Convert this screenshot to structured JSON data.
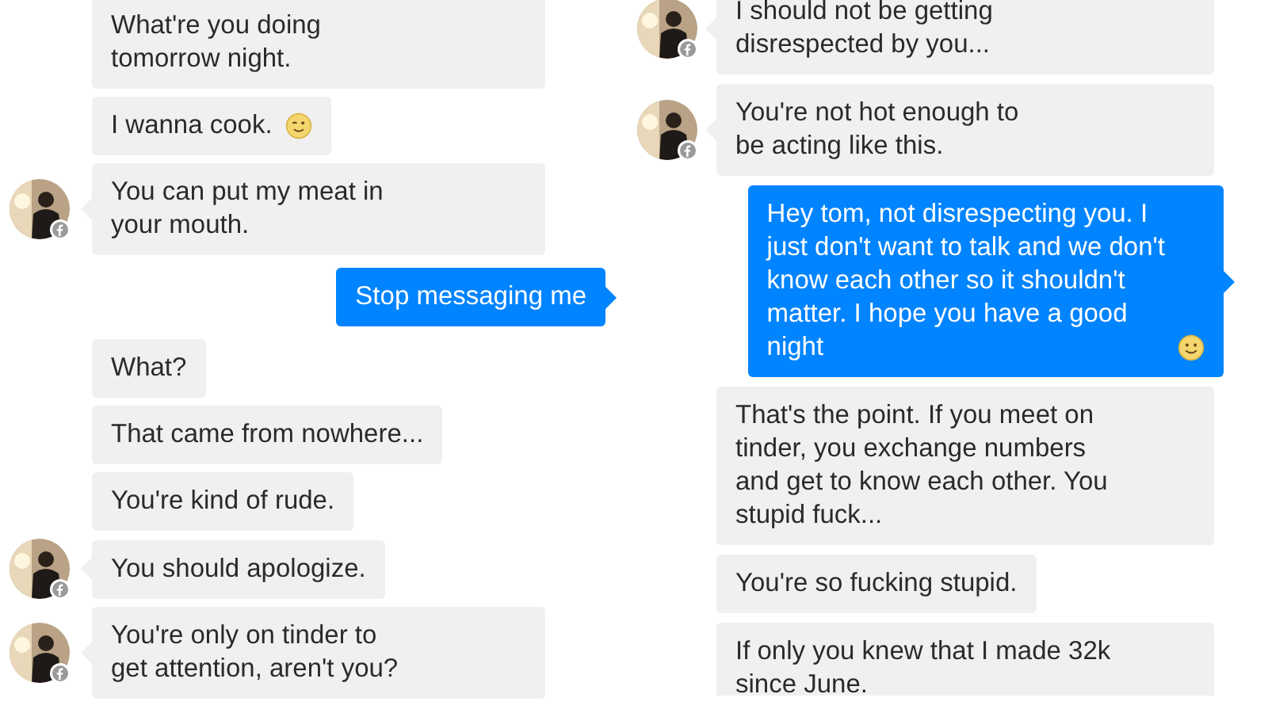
{
  "columns": [
    {
      "messages": [
        {
          "kind": "received",
          "avatar": false,
          "text": "What're you doing\ntomorrow night."
        },
        {
          "kind": "received",
          "avatar": false,
          "text": "I wanna cook.",
          "emoji": {
            "kind": "wink"
          }
        },
        {
          "kind": "received",
          "avatar": true,
          "text": "You can put my meat in\nyour mouth."
        },
        {
          "kind": "sent",
          "text": "Stop messaging me"
        },
        {
          "kind": "received",
          "avatar": false,
          "text": "What?"
        },
        {
          "kind": "received",
          "avatar": false,
          "text": "That came from nowhere..."
        },
        {
          "kind": "received",
          "avatar": false,
          "text": "You're kind of rude."
        },
        {
          "kind": "received",
          "avatar": true,
          "text": "You should apologize."
        },
        {
          "kind": "received",
          "avatar": true,
          "text": "You're only on tinder to\nget attention, aren't you?"
        }
      ]
    },
    {
      "messages": [
        {
          "kind": "received",
          "avatar": true,
          "text": "I should not be getting\ndisrespected by you..."
        },
        {
          "kind": "received",
          "avatar": true,
          "text": "You're not hot enough to\nbe acting like this."
        },
        {
          "kind": "sent",
          "text": "Hey tom, not disrespecting you.  I\njust don't want to talk and we don't\nknow each other so it shouldn't\nmatter. I hope you have a good\nnight",
          "emoji": {
            "kind": "smile"
          }
        },
        {
          "kind": "received",
          "avatar": false,
          "text": "That's the point.  If you meet on\ntinder, you exchange numbers\nand get to know each other.  You\nstupid fuck..."
        },
        {
          "kind": "received",
          "avatar": false,
          "text": "You're so fucking stupid."
        },
        {
          "kind": "received",
          "avatar": false,
          "text": "If only you knew that I made 32k\nsince June."
        }
      ]
    }
  ]
}
